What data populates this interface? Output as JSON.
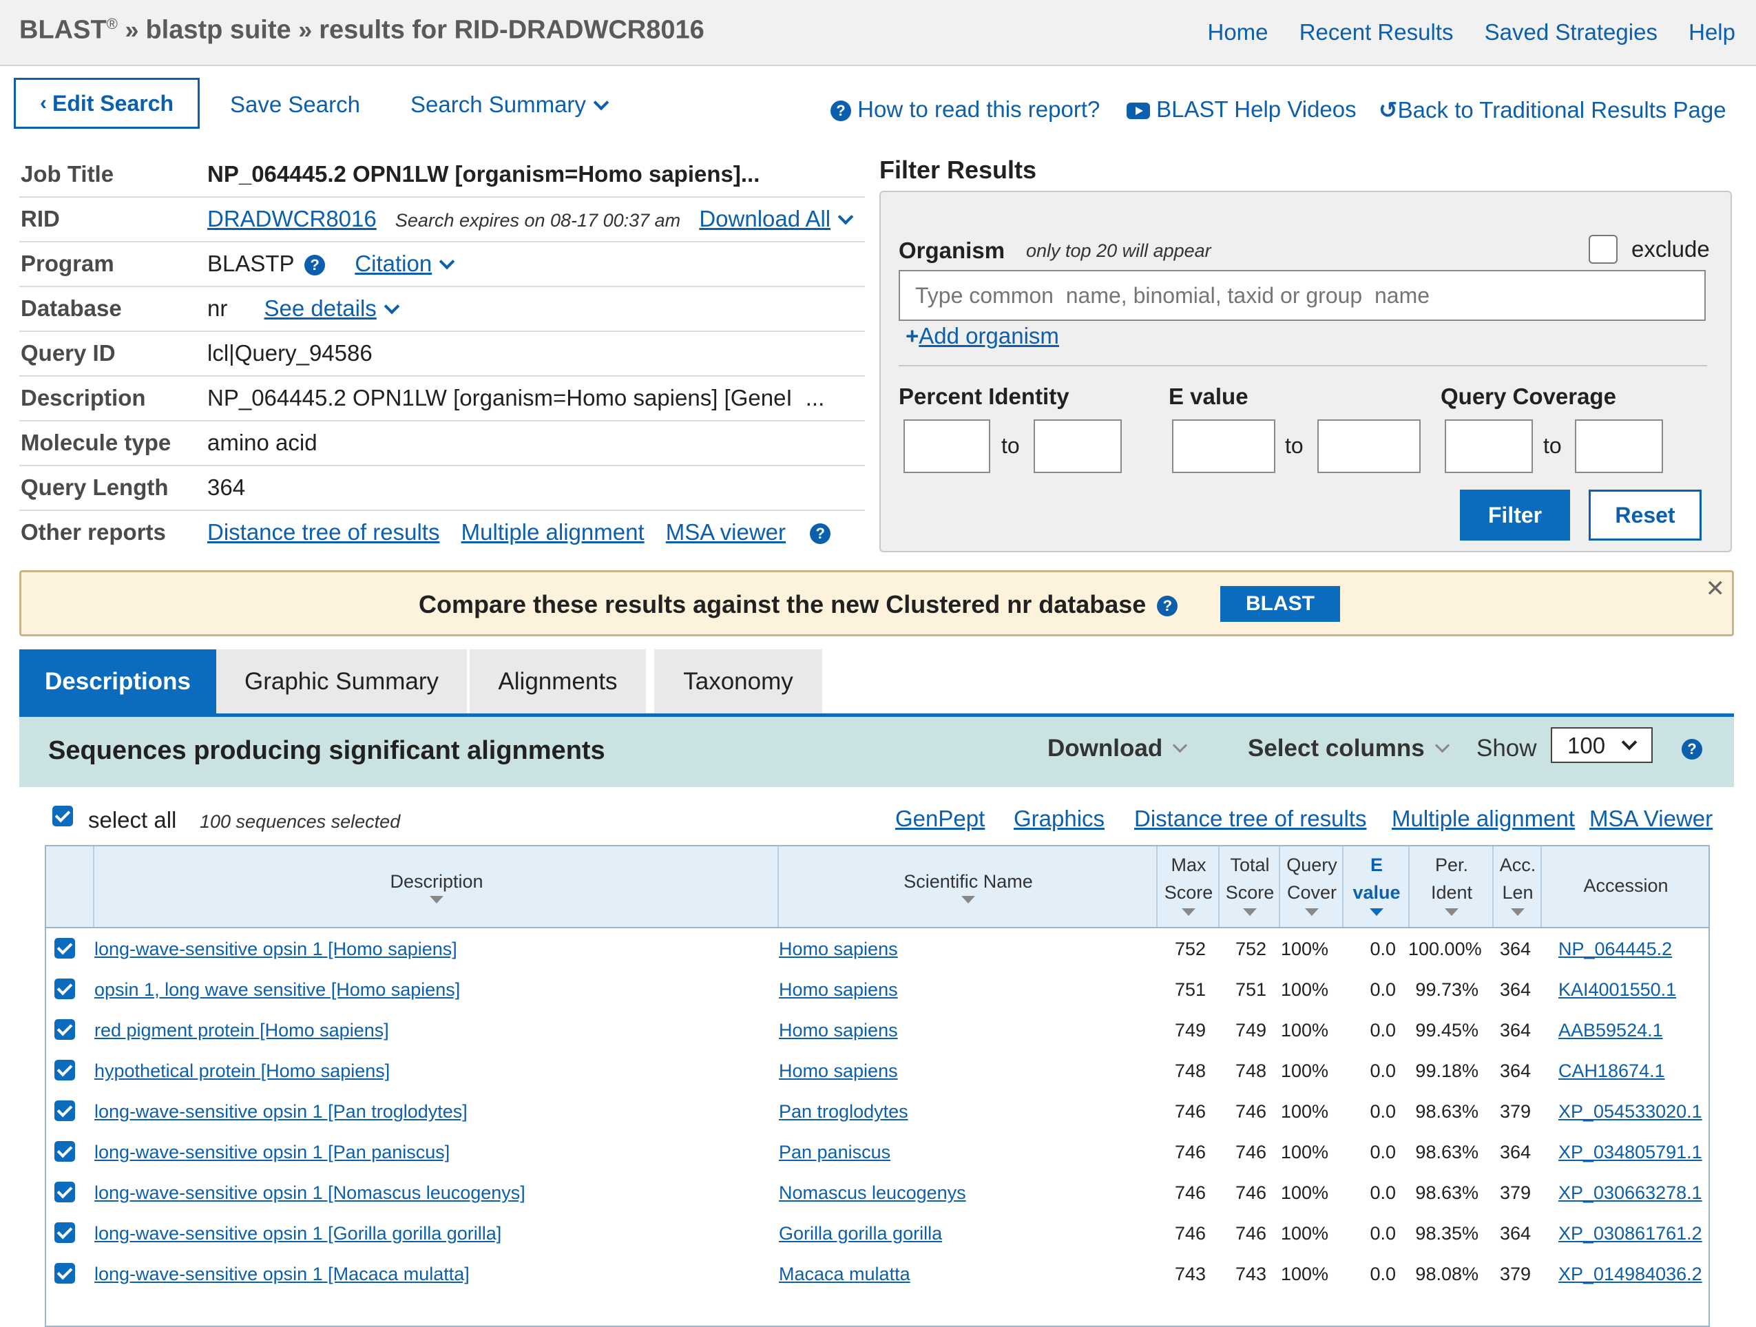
{
  "header": {
    "app": "BLAST",
    "reg": "®",
    "crumb1": "blastp suite",
    "crumb2": "results for RID-DRADWCR8016",
    "nav": [
      "Home",
      "Recent Results",
      "Saved Strategies",
      "Help"
    ]
  },
  "toolbar": {
    "edit_search": "Edit Search",
    "save_search": "Save Search",
    "search_summary": "Search Summary",
    "how_to_read": "How to read this report?",
    "help_videos": "BLAST Help Videos",
    "back_traditional": "Back to Traditional Results Page"
  },
  "job": {
    "title_label": "Job Title",
    "title_value": "NP_064445.2 OPN1LW [organism=Homo sapiens]...",
    "rid_label": "RID",
    "rid_value": "DRADWCR8016",
    "rid_expires": "Search expires on 08-17 00:37 am",
    "download_all": "Download All",
    "program_label": "Program",
    "program_value": "BLASTP",
    "citation": "Citation",
    "database_label": "Database",
    "database_value": "nr",
    "see_details": "See details",
    "query_id_label": "Query ID",
    "query_id_value": "lcl|Query_94586",
    "description_label": "Description",
    "description_value": "NP_064445.2 OPN1LW [organism=Homo sapiens] [GeneI",
    "description_more": "...",
    "molecule_label": "Molecule type",
    "molecule_value": "amino acid",
    "length_label": "Query Length",
    "length_value": "364",
    "other_label": "Other reports",
    "other_links": [
      "Distance tree of results",
      "Multiple alignment",
      "MSA viewer"
    ]
  },
  "filter": {
    "title": "Filter Results",
    "organism_label": "Organism",
    "organism_hint": "only top 20 will appear",
    "exclude": "exclude",
    "organism_placeholder": "Type common  name, binomial, taxid or group  name",
    "add_organism": "Add organism",
    "percent_identity": "Percent Identity",
    "evalue": "E value",
    "query_coverage": "Query Coverage",
    "to": "to",
    "filter_btn": "Filter",
    "reset_btn": "Reset"
  },
  "banner": {
    "text": "Compare these results against the new Clustered nr database",
    "button": "BLAST",
    "close": "✕"
  },
  "tabs": [
    "Descriptions",
    "Graphic Summary",
    "Alignments",
    "Taxonomy"
  ],
  "results": {
    "title": "Sequences producing significant alignments",
    "download": "Download",
    "select_columns": "Select columns",
    "show_label": "Show",
    "show_value": "100",
    "select_all": "select all",
    "selected_count": "100 sequences selected",
    "links": [
      "GenPept",
      "Graphics",
      "Distance tree of results",
      "Multiple alignment",
      "MSA Viewer"
    ],
    "columns": {
      "description": "Description",
      "scientific": "Scientific Name",
      "max1": "Max",
      "max2": "Score",
      "total1": "Total",
      "total2": "Score",
      "qc1": "Query",
      "qc2": "Cover",
      "ev1": "E",
      "ev2": "value",
      "pi1": "Per.",
      "pi2": "Ident",
      "acc1": "Acc.",
      "acc2": "Len",
      "accession": "Accession"
    },
    "rows": [
      {
        "desc": "long-wave-sensitive opsin 1 [Homo sapiens]",
        "sci": "Homo sapiens",
        "max": "752",
        "total": "752",
        "qc": "100%",
        "ev": "0.0",
        "pi": "100.00%",
        "len": "364",
        "acc": "NP_064445.2"
      },
      {
        "desc": "opsin 1, long wave sensitive [Homo sapiens]",
        "sci": "Homo sapiens",
        "max": "751",
        "total": "751",
        "qc": "100%",
        "ev": "0.0",
        "pi": "99.73%",
        "len": "364",
        "acc": "KAI4001550.1"
      },
      {
        "desc": "red pigment protein [Homo sapiens]",
        "sci": "Homo sapiens",
        "max": "749",
        "total": "749",
        "qc": "100%",
        "ev": "0.0",
        "pi": "99.45%",
        "len": "364",
        "acc": "AAB59524.1"
      },
      {
        "desc": "hypothetical protein [Homo sapiens]",
        "sci": "Homo sapiens",
        "max": "748",
        "total": "748",
        "qc": "100%",
        "ev": "0.0",
        "pi": "99.18%",
        "len": "364",
        "acc": "CAH18674.1"
      },
      {
        "desc": "long-wave-sensitive opsin 1 [Pan troglodytes]",
        "sci": "Pan troglodytes",
        "max": "746",
        "total": "746",
        "qc": "100%",
        "ev": "0.0",
        "pi": "98.63%",
        "len": "379",
        "acc": "XP_054533020.1"
      },
      {
        "desc": "long-wave-sensitive opsin 1 [Pan paniscus]",
        "sci": "Pan paniscus",
        "max": "746",
        "total": "746",
        "qc": "100%",
        "ev": "0.0",
        "pi": "98.63%",
        "len": "364",
        "acc": "XP_034805791.1"
      },
      {
        "desc": "long-wave-sensitive opsin 1 [Nomascus leucogenys]",
        "sci": "Nomascus leucogenys",
        "max": "746",
        "total": "746",
        "qc": "100%",
        "ev": "0.0",
        "pi": "98.63%",
        "len": "379",
        "acc": "XP_030663278.1"
      },
      {
        "desc": "long-wave-sensitive opsin 1 [Gorilla gorilla gorilla]",
        "sci": "Gorilla gorilla gorilla",
        "max": "746",
        "total": "746",
        "qc": "100%",
        "ev": "0.0",
        "pi": "98.35%",
        "len": "364",
        "acc": "XP_030861761.2"
      },
      {
        "desc": "long-wave-sensitive opsin 1 [Macaca mulatta]",
        "sci": "Macaca mulatta",
        "max": "743",
        "total": "743",
        "qc": "100%",
        "ev": "0.0",
        "pi": "98.08%",
        "len": "379",
        "acc": "XP_014984036.2"
      }
    ]
  },
  "colors": {
    "link": "#0b5fad",
    "accent": "#0b6cbd",
    "banner_bg": "#fdf3dd",
    "section_bg": "#cbe2e3",
    "table_head": "#e2eef8"
  }
}
